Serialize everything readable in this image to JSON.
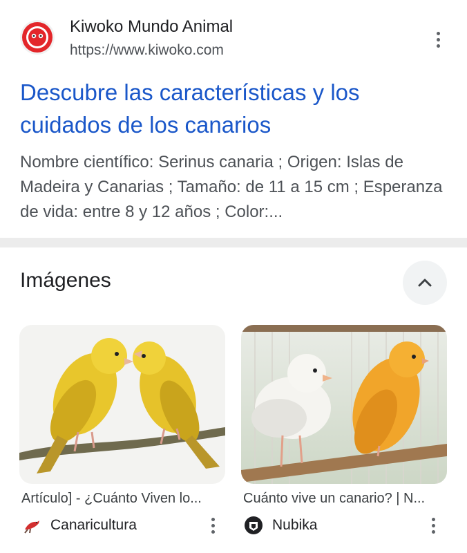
{
  "result": {
    "site_name": "Kiwoko Mundo Animal",
    "site_url": "https://www.kiwoko.com",
    "title": "Descubre las características y los cuidados de los canarios",
    "snippet": "Nombre científico: Serinus canaria ; Origen: Islas de Madeira y Canarias ; Tamaño: de 11 a 15 cm ; Esperanza de vida: entre 8 y 12 años ; Color:...",
    "favicon_icon": "kiwoko-logo-icon",
    "accent_color": "#1a57c9"
  },
  "images_section": {
    "heading": "Imágenes",
    "collapse_icon": "chevron-up-icon",
    "cards": [
      {
        "image": "two-yellow-canaries-on-branch",
        "caption": "Artículo] - ¿Cuánto Viven lo...",
        "source": "Canaricultura",
        "source_icon": "red-bird-icon"
      },
      {
        "image": "white-and-orange-canaries-on-perch",
        "caption": "Cuánto vive un canario? | N...",
        "source": "Nubika",
        "source_icon": "nubika-logo-icon"
      }
    ]
  }
}
